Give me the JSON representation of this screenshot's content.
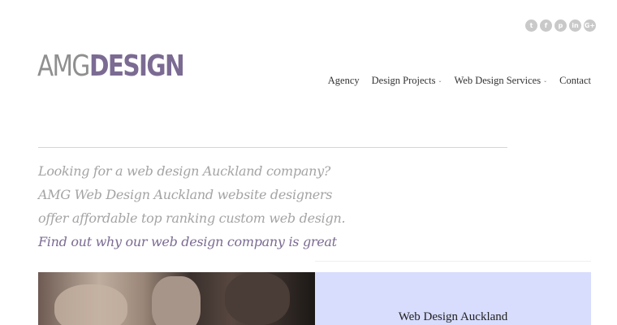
{
  "social": [
    {
      "icon": "twitter-icon",
      "glyph": "t"
    },
    {
      "icon": "facebook-icon",
      "glyph": "f"
    },
    {
      "icon": "pinterest-icon",
      "glyph": "p"
    },
    {
      "icon": "linkedin-icon",
      "glyph": "in"
    },
    {
      "icon": "google-plus-icon",
      "glyph": "G+"
    }
  ],
  "logo": {
    "part1": "AMG",
    "part2": "DESIGN"
  },
  "nav": {
    "agency": "Agency",
    "design_projects": "Design Projects",
    "web_design_services": "Web Design Services",
    "contact": "Contact"
  },
  "intro": {
    "line1": "Looking for a web design Auckland company?",
    "line2": "AMG Web Design Auckland website designers",
    "line3": "offer affordable top ranking custom web design.",
    "cta": "Find out why our web design company is great"
  },
  "panel": {
    "title": "Web Design Auckland"
  },
  "colors": {
    "accent": "#7b6b93",
    "panel_bg": "#d8dcfd",
    "muted_text": "#a4a4a4"
  }
}
